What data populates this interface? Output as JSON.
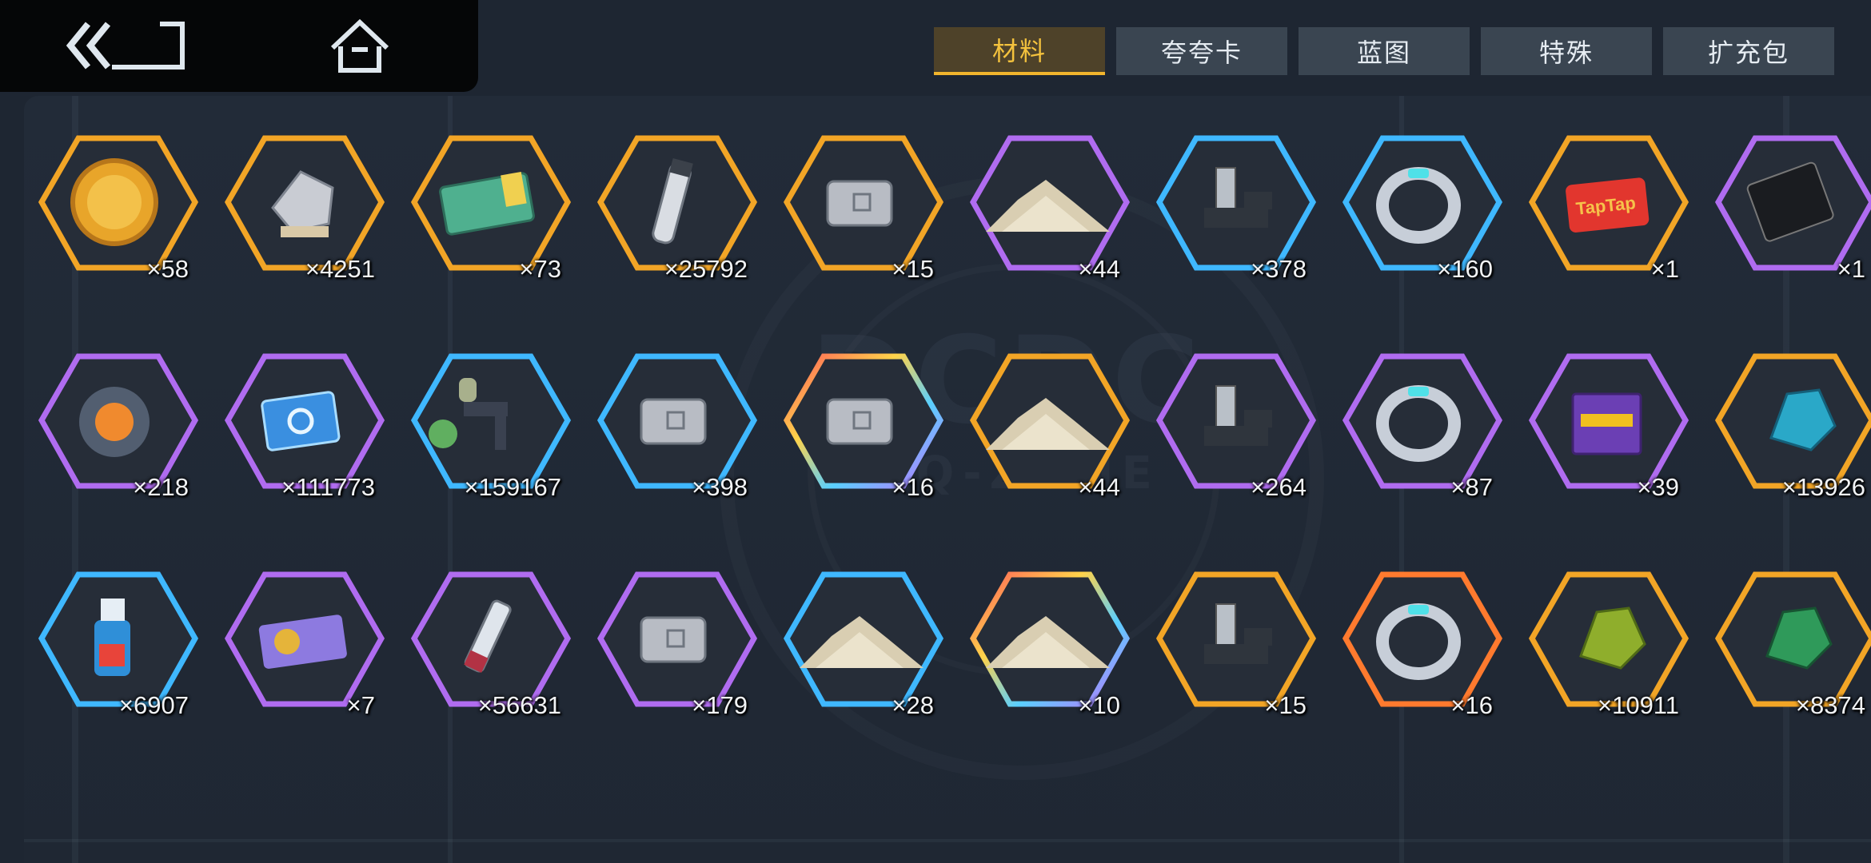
{
  "tabs": [
    {
      "label": "材料",
      "active": true
    },
    {
      "label": "夸夸卡",
      "active": false
    },
    {
      "label": "蓝图",
      "active": false
    },
    {
      "label": "特殊",
      "active": false
    },
    {
      "label": "扩充包",
      "active": false
    }
  ],
  "colors": {
    "accent": "#f2b52d",
    "rarity_gold": "#f2a526",
    "rarity_purple": "#b06cf0",
    "rarity_blue": "#3fb8ff",
    "rarity_orange": "#ff7a2e"
  },
  "items": [
    {
      "count": "×58",
      "icon": "gold-coin-icon",
      "rarity": "gold"
    },
    {
      "count": "×4251",
      "icon": "silver-ore-icon",
      "rarity": "gold"
    },
    {
      "count": "×73",
      "icon": "ticket-card-icon",
      "rarity": "gold"
    },
    {
      "count": "×25792",
      "icon": "vial-icon",
      "rarity": "gold"
    },
    {
      "count": "×15",
      "icon": "hex-plate-icon",
      "rarity": "gold"
    },
    {
      "count": "×44",
      "icon": "sand-pile-icon",
      "rarity": "purple"
    },
    {
      "count": "×378",
      "icon": "machine-part-icon",
      "rarity": "blue"
    },
    {
      "count": "×160",
      "icon": "ring-icon",
      "rarity": "blue"
    },
    {
      "count": "×1",
      "icon": "taptap-card-icon",
      "rarity": "gold"
    },
    {
      "count": "×1",
      "icon": "black-card-icon",
      "rarity": "purple"
    },
    {
      "count": "×218",
      "icon": "flower-orb-icon",
      "rarity": "purple"
    },
    {
      "count": "×111773",
      "icon": "chip-card-icon",
      "rarity": "purple"
    },
    {
      "count": "×159167",
      "icon": "spray-gun-icon",
      "rarity": "blue"
    },
    {
      "count": "×398",
      "icon": "hex-plate-icon",
      "rarity": "blue"
    },
    {
      "count": "×16",
      "icon": "hex-plate-icon",
      "rarity": "rainbow"
    },
    {
      "count": "×44",
      "icon": "sand-pile-icon",
      "rarity": "gold"
    },
    {
      "count": "×264",
      "icon": "machine-part-icon",
      "rarity": "purple"
    },
    {
      "count": "×87",
      "icon": "ring-icon",
      "rarity": "purple"
    },
    {
      "count": "×39",
      "icon": "book-icon",
      "rarity": "purple"
    },
    {
      "count": "×13926",
      "icon": "blue-crystal-icon",
      "rarity": "gold"
    },
    {
      "count": "×6907",
      "icon": "spray-bottle-icon",
      "rarity": "blue"
    },
    {
      "count": "×7",
      "icon": "ticket-stub-icon",
      "rarity": "purple"
    },
    {
      "count": "×56631",
      "icon": "syringe-icon",
      "rarity": "purple"
    },
    {
      "count": "×179",
      "icon": "hex-plate-icon",
      "rarity": "purple"
    },
    {
      "count": "×28",
      "icon": "sand-pile-icon",
      "rarity": "blue"
    },
    {
      "count": "×10",
      "icon": "sand-pile-icon",
      "rarity": "rainbow"
    },
    {
      "count": "×15",
      "icon": "machine-part-icon",
      "rarity": "gold"
    },
    {
      "count": "×16",
      "icon": "ring-icon",
      "rarity": "orange"
    },
    {
      "count": "×10911",
      "icon": "green-crystal-icon",
      "rarity": "gold"
    },
    {
      "count": "×8374",
      "icon": "emerald-crystal-icon",
      "rarity": "gold"
    }
  ]
}
